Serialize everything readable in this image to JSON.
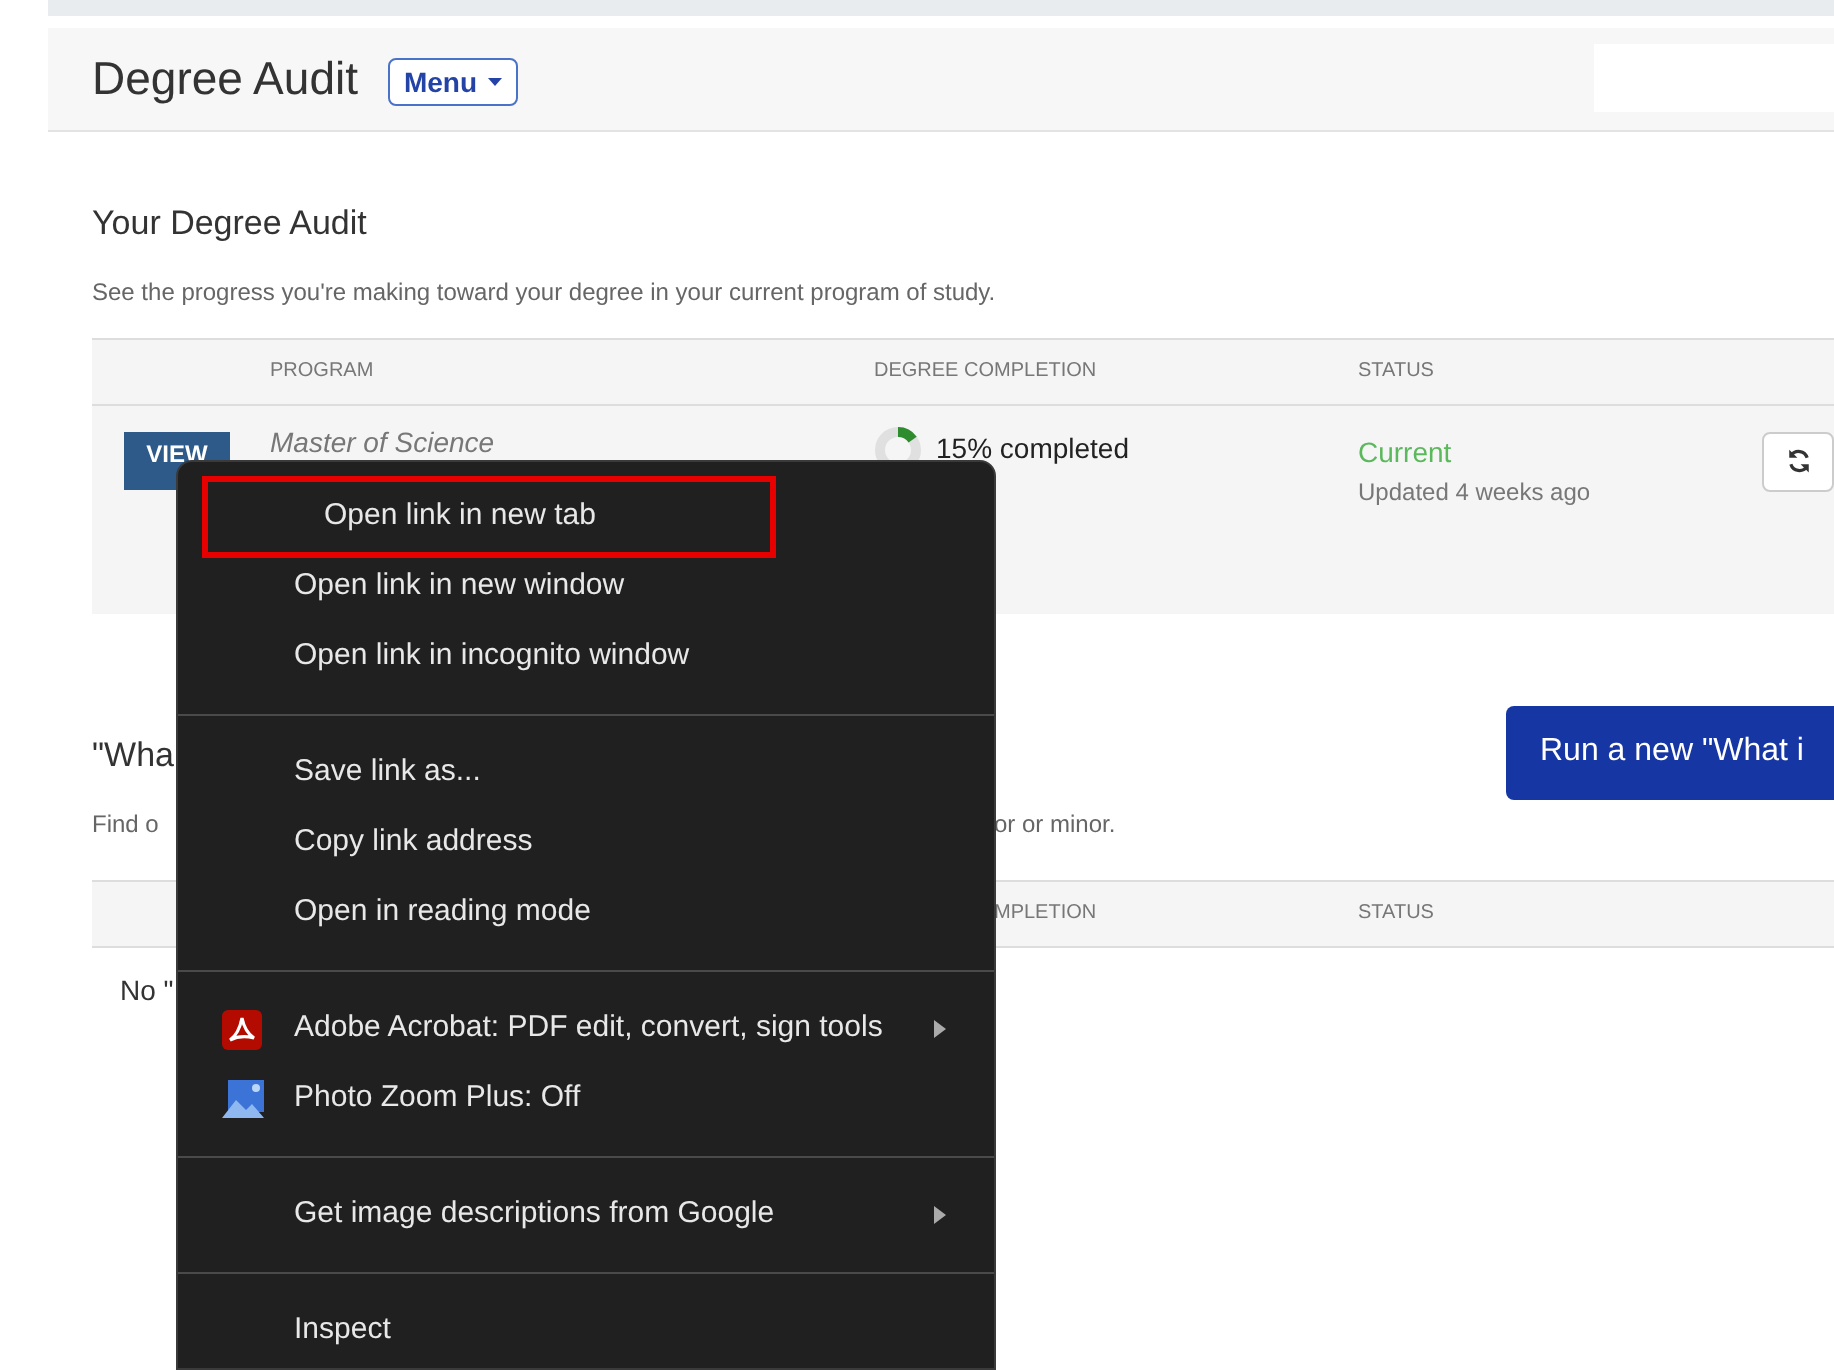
{
  "header": {
    "title": "Degree Audit",
    "menu_button": "Menu"
  },
  "degree_audit": {
    "heading": "Your Degree Audit",
    "description": "See the progress you're making toward your degree in your current program of study.",
    "columns": [
      "PROGRAM",
      "DEGREE COMPLETION",
      "STATUS"
    ],
    "rows": [
      {
        "action": "VIEW",
        "program": "Master of Science",
        "level": 0.15,
        "completion": "15% completed",
        "status": "Current",
        "updated": "Updated 4 weeks ago"
      }
    ]
  },
  "what_if": {
    "heading": "\"Wha",
    "description": "Find o",
    "description_end": "or or minor.",
    "run_button": "Run a new \"What i",
    "columns": [
      "MPLETION",
      "STATUS"
    ],
    "empty_text": "No \""
  },
  "context_menu": {
    "groups": [
      [
        {
          "label": "Open link in new tab",
          "highlighted": true,
          "submenu": false
        },
        {
          "label": "Open link in new window",
          "highlighted": false,
          "submenu": false
        },
        {
          "label": "Open link in incognito window",
          "highlighted": false,
          "submenu": false
        }
      ],
      [
        {
          "label": "Save link as...",
          "highlighted": false,
          "submenu": false
        },
        {
          "label": "Copy link address",
          "highlighted": false,
          "submenu": false
        },
        {
          "label": "Open in reading mode",
          "highlighted": false,
          "submenu": false
        }
      ],
      [
        {
          "label": "Adobe Acrobat: PDF edit, convert, sign tools",
          "highlighted": false,
          "submenu": true,
          "kind": "acrobat"
        },
        {
          "label": "Photo Zoom Plus: Off",
          "highlighted": false,
          "submenu": false,
          "kind": "photo"
        }
      ],
      [
        {
          "label": "Get image descriptions from Google",
          "highlighted": false,
          "submenu": true
        }
      ],
      [
        {
          "label": "Inspect",
          "highlighted": false,
          "submenu": false
        }
      ]
    ]
  }
}
